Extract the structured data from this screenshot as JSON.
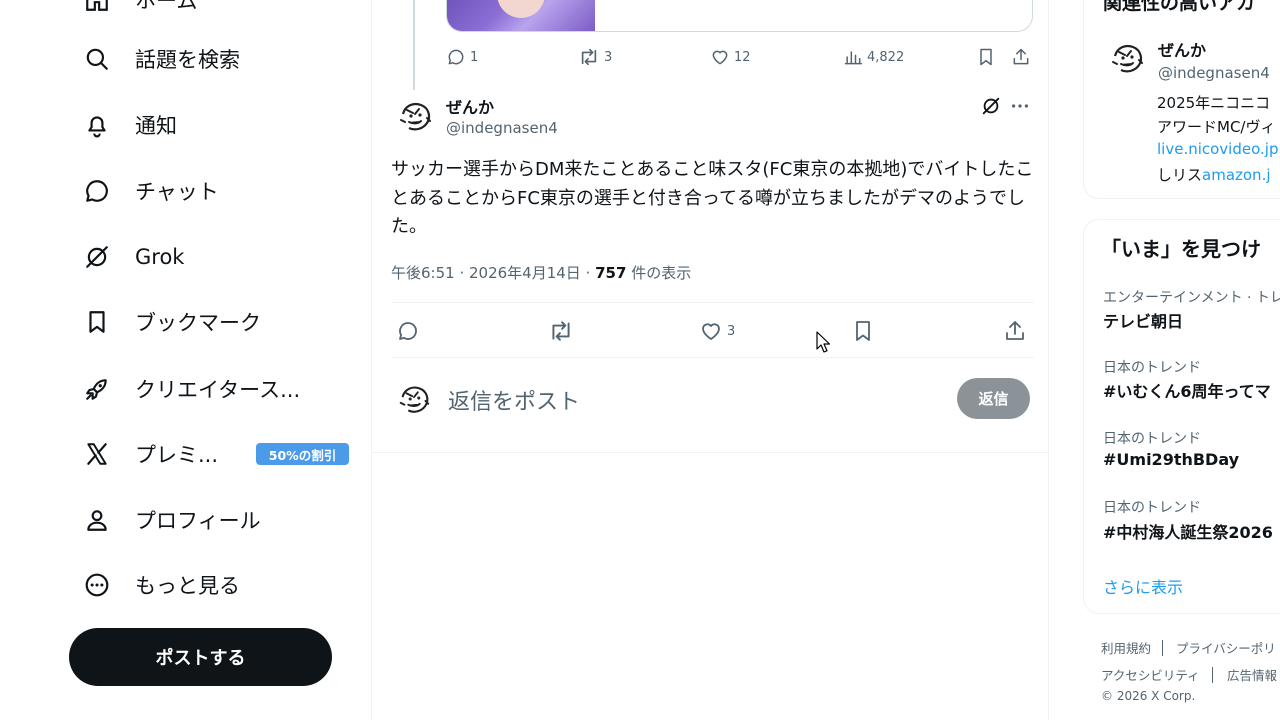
{
  "sidebar": {
    "items": [
      {
        "label": "ホーム",
        "icon": "home-icon"
      },
      {
        "label": "話題を検索",
        "icon": "search-icon"
      },
      {
        "label": "通知",
        "icon": "bell-icon"
      },
      {
        "label": "チャット",
        "icon": "chat-icon"
      },
      {
        "label": "Grok",
        "icon": "grok-icon"
      },
      {
        "label": "ブックマーク",
        "icon": "bookmark-icon"
      },
      {
        "label": "クリエイタース...",
        "icon": "rocket-icon"
      },
      {
        "label": "プレミ...",
        "icon": "x-logo-icon"
      },
      {
        "label": "プロフィール",
        "icon": "person-icon"
      },
      {
        "label": "もっと見る",
        "icon": "more-circle-icon"
      }
    ],
    "premium_badge": "50%の割引",
    "post_button": "ポストする"
  },
  "prev_tweet": {
    "replies": "1",
    "reposts": "3",
    "likes": "12",
    "views": "4,822"
  },
  "tweet": {
    "name": "ぜんか",
    "handle": "@indegnasen4",
    "body": "サッカー選手からDM来たことあること味スタ(FC東京の本拠地)でバイトしたことあることからFC東京の選手と付き合ってる噂が立ちましたがデマのようでした。",
    "time": "午後6:51 · 2026年4月14日 · ",
    "views": "757",
    "views_label": " 件の表示",
    "likes": "3"
  },
  "reply_box": {
    "placeholder": "返信をポスト",
    "button": "返信"
  },
  "related": {
    "title": "関連性の高いアカ",
    "name": "ぜんか",
    "handle": "@indegnasen4",
    "bio_line1": "2025年ニコニコ",
    "bio_line2": "アワードMC/ヴィ",
    "bio_link1": "live.nicovideo.jp",
    "bio_line3_prefix": "しリス",
    "bio_link2": "amazon.j"
  },
  "trends": {
    "title": "「いま」を見つけ",
    "items": [
      {
        "category": "エンターテインメント · トレ",
        "name": "テレビ朝日"
      },
      {
        "category": "日本のトレンド",
        "name": "#いむくん6周年ってマ"
      },
      {
        "category": "日本のトレンド",
        "name": "#Umi29thBDay"
      },
      {
        "category": "日本のトレンド",
        "name": "#中村海人誕生祭2026"
      }
    ],
    "show_more": "さらに表示"
  },
  "footer": {
    "terms": "利用規約",
    "privacy": "プライバシーポリ",
    "accessibility": "アクセシビリティ",
    "ads": "広告情報",
    "copyright": "© 2026 X Corp."
  },
  "colors": {
    "accent": "#1d9bf0",
    "premium_badge": "#4c9be8",
    "text_primary": "#0f1419",
    "text_secondary": "#536471"
  }
}
